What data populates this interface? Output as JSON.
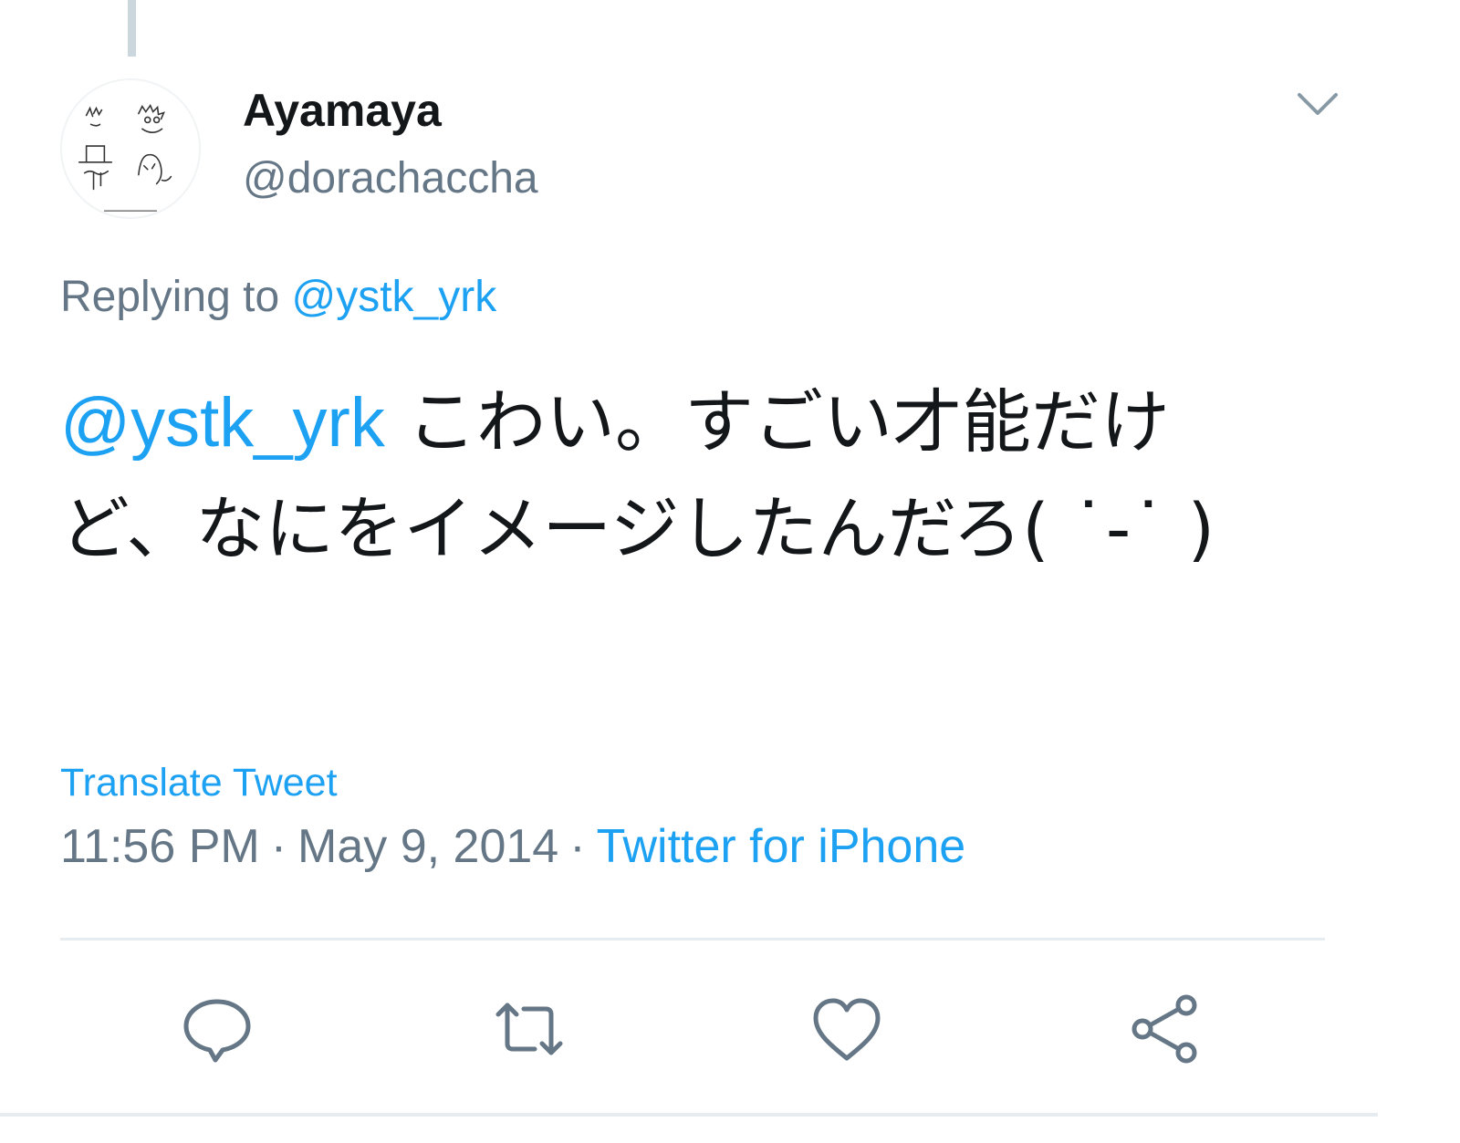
{
  "tweet": {
    "display_name": "Ayamaya",
    "handle": "@dorachaccha",
    "replying_prefix": "Replying to",
    "replying_handle": "@ystk_yrk",
    "text_mention": "@ystk_yrk",
    "text_body": " こわい。すごい才能だけど、なにをイメージしたんだろ( ˙-˙ )",
    "translate_label": "Translate Tweet",
    "time": "11:56 PM",
    "separator": "·",
    "date": "May 9, 2014",
    "source": "Twitter for iPhone"
  },
  "actions": {
    "reply_icon": "reply-icon",
    "retweet_icon": "retweet-icon",
    "like_icon": "heart-icon",
    "share_icon": "share-icon"
  },
  "colors": {
    "link": "#1da1f2",
    "secondary_text": "#657786",
    "primary_text": "#14171a",
    "divider": "#e6ecf0"
  }
}
